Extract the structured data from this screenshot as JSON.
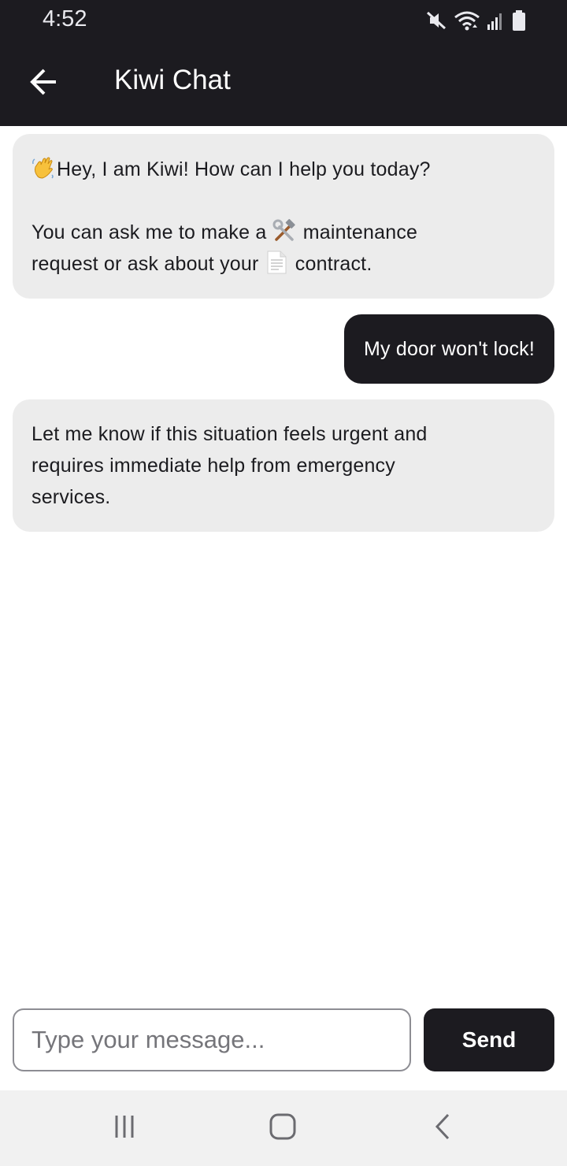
{
  "status_bar": {
    "time": "4:52",
    "icons": [
      "mute-icon",
      "wifi-icon",
      "signal-icon",
      "battery-icon"
    ]
  },
  "app_bar": {
    "title": "Kiwi Chat",
    "back_icon": "arrow-left-icon"
  },
  "messages": [
    {
      "sender": "bot",
      "emoji_1": "waving-hand-emoji",
      "line_1": "Hey, I am Kiwi! How can I help you today?",
      "line_2a": "You can ask me to make a ",
      "emoji_2": "hammer-and-wrench-emoji",
      "line_2b": " maintenance",
      "line_3a": "request or ask about your ",
      "emoji_3": "page-facing-up-emoji",
      "line_3b": " contract."
    },
    {
      "sender": "user",
      "text": "My door won't lock!"
    },
    {
      "sender": "bot",
      "line_1": "Let me know if this situation feels urgent and",
      "line_2": "requires immediate help from emergency",
      "line_3": "services."
    }
  ],
  "composer": {
    "placeholder": "Type your message...",
    "value": "",
    "send_label": "Send"
  },
  "nav_bar": {
    "items": [
      "recent-apps-icon",
      "home-icon",
      "back-icon"
    ]
  },
  "colors": {
    "bar_dark": "#1c1b20",
    "bot_bubble": "#ececec",
    "user_bubble": "#1c1b20",
    "nav_bar": "#f1f1f1"
  }
}
